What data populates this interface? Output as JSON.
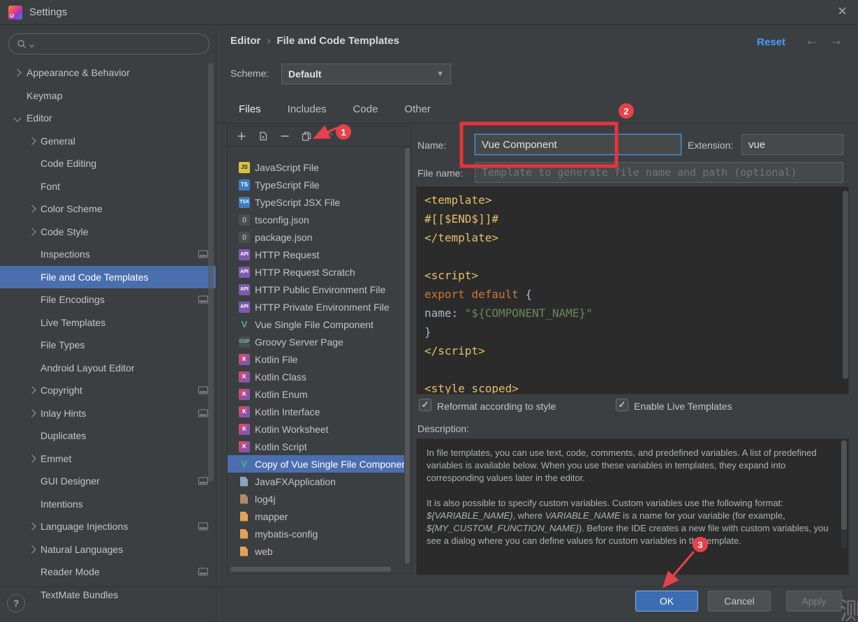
{
  "window": {
    "title": "Settings",
    "close_icon": "×"
  },
  "sidebar": {
    "search_placeholder": "",
    "items": [
      {
        "label": "Appearance & Behavior",
        "level": 1,
        "chevron": "right"
      },
      {
        "label": "Keymap",
        "level": 1
      },
      {
        "label": "Editor",
        "level": 1,
        "chevron": "down"
      },
      {
        "label": "General",
        "level": 2,
        "chevron": "right"
      },
      {
        "label": "Code Editing",
        "level": 2
      },
      {
        "label": "Font",
        "level": 2
      },
      {
        "label": "Color Scheme",
        "level": 2,
        "chevron": "right"
      },
      {
        "label": "Code Style",
        "level": 2,
        "chevron": "right"
      },
      {
        "label": "Inspections",
        "level": 2,
        "badge": true
      },
      {
        "label": "File and Code Templates",
        "level": 2,
        "selected": true
      },
      {
        "label": "File Encodings",
        "level": 2,
        "badge": true
      },
      {
        "label": "Live Templates",
        "level": 2
      },
      {
        "label": "File Types",
        "level": 2
      },
      {
        "label": "Android Layout Editor",
        "level": 2
      },
      {
        "label": "Copyright",
        "level": 2,
        "chevron": "right",
        "badge": true
      },
      {
        "label": "Inlay Hints",
        "level": 2,
        "chevron": "right",
        "badge": true
      },
      {
        "label": "Duplicates",
        "level": 2
      },
      {
        "label": "Emmet",
        "level": 2,
        "chevron": "right"
      },
      {
        "label": "GUI Designer",
        "level": 2,
        "badge": true
      },
      {
        "label": "Intentions",
        "level": 2
      },
      {
        "label": "Language Injections",
        "level": 2,
        "chevron": "right",
        "badge": true
      },
      {
        "label": "Natural Languages",
        "level": 2,
        "chevron": "right"
      },
      {
        "label": "Reader Mode",
        "level": 2,
        "badge": true
      },
      {
        "label": "TextMate Bundles",
        "level": 2
      }
    ],
    "help_label": "?"
  },
  "header": {
    "breadcrumb_1": "Editor",
    "breadcrumb_sep": "›",
    "breadcrumb_2": "File and Code Templates",
    "reset_label": "Reset",
    "back_icon": "←",
    "forward_icon": "→"
  },
  "scheme": {
    "label": "Scheme:",
    "value": "Default"
  },
  "tabs": [
    {
      "label": "Files",
      "active": true
    },
    {
      "label": "Includes"
    },
    {
      "label": "Code"
    },
    {
      "label": "Other"
    }
  ],
  "template_list": {
    "items": [
      {
        "label": "JavaScript File",
        "icon": "JS",
        "icon_bg": "#d9c441",
        "icon_fg": "#2b2b2b"
      },
      {
        "label": "TypeScript File",
        "icon": "TS",
        "icon_bg": "#3c7bbf",
        "icon_fg": "#ffffff"
      },
      {
        "label": "TypeScript JSX File",
        "icon": "TSX",
        "icon_bg": "#3c7bbf",
        "icon_fg": "#ffffff"
      },
      {
        "label": "tsconfig.json",
        "icon": "{}",
        "icon_bg": "#4a4e50",
        "icon_fg": "#b5c0c7"
      },
      {
        "label": "package.json",
        "icon": "{}",
        "icon_bg": "#4a4e50",
        "icon_fg": "#b5c0c7"
      },
      {
        "label": "HTTP Request",
        "icon": "API",
        "icon_bg": "#7d5bb0",
        "icon_fg": "#ffffff"
      },
      {
        "label": "HTTP Request Scratch",
        "icon": "API",
        "icon_bg": "#7d5bb0",
        "icon_fg": "#ffffff"
      },
      {
        "label": "HTTP Public Environment File",
        "icon": "API",
        "icon_bg": "#7d5bb0",
        "icon_fg": "#ffffff"
      },
      {
        "label": "HTTP Private Environment File",
        "icon": "API",
        "icon_bg": "#7d5bb0",
        "icon_fg": "#ffffff"
      },
      {
        "label": "Vue Single File Component",
        "icon": "V",
        "icon_bg": "transparent",
        "icon_fg": "#42b883"
      },
      {
        "label": "Groovy Server Page",
        "icon": "GSP",
        "icon_bg": "#4a4e50",
        "icon_fg": "#79c99d"
      },
      {
        "label": "Kotlin File",
        "icon": "K",
        "icon_bg": "linear-gradient(135deg,#e24f59,#9e4d9e 55%,#6563b5)",
        "icon_fg": "#ffffff"
      },
      {
        "label": "Kotlin Class",
        "icon": "K",
        "icon_bg": "linear-gradient(135deg,#e24f59,#9e4d9e 55%,#6563b5)",
        "icon_fg": "#ffffff"
      },
      {
        "label": "Kotlin Enum",
        "icon": "K",
        "icon_bg": "linear-gradient(135deg,#e24f59,#9e4d9e 55%,#6563b5)",
        "icon_fg": "#ffffff"
      },
      {
        "label": "Kotlin Interface",
        "icon": "K",
        "icon_bg": "linear-gradient(135deg,#e24f59,#9e4d9e 55%,#6563b5)",
        "icon_fg": "#ffffff"
      },
      {
        "label": "Kotlin Worksheet",
        "icon": "K",
        "icon_bg": "linear-gradient(135deg,#e24f59,#9e4d9e 55%,#6563b5)",
        "icon_fg": "#ffffff"
      },
      {
        "label": "Kotlin Script",
        "icon": "K",
        "icon_bg": "linear-gradient(135deg,#e24f59,#9e4d9e 55%,#6563b5)",
        "icon_fg": "#ffffff"
      },
      {
        "label": "Copy of Vue Single File Component",
        "icon": "V",
        "icon_bg": "transparent",
        "icon_fg": "#42b883",
        "selected": true
      },
      {
        "label": "JavaFXApplication",
        "icon": "file",
        "icon_fg": "#87a6c0"
      },
      {
        "label": "log4j",
        "icon": "file",
        "icon_fg": "#b08968"
      },
      {
        "label": "mapper",
        "icon": "file",
        "icon_fg": "#e2a256"
      },
      {
        "label": "mybatis-config",
        "icon": "file",
        "icon_fg": "#e2a256"
      },
      {
        "label": "web",
        "icon": "file",
        "icon_fg": "#e2a256"
      }
    ]
  },
  "detail": {
    "name_label": "Name:",
    "name_value": "Vue Component",
    "extension_label": "Extension:",
    "extension_value": "vue",
    "filename_label": "File name:",
    "filename_placeholder": "Template to generate file name and path (optional)",
    "code_lines": [
      [
        {
          "t": "<template>",
          "c": "tag"
        }
      ],
      [
        {
          "t": "#[[$END$]]#",
          "c": "tag"
        }
      ],
      [
        {
          "t": "</template>",
          "c": "tag"
        }
      ],
      [],
      [
        {
          "t": "<script>",
          "c": "tag"
        }
      ],
      [
        {
          "t": "export default ",
          "c": "kw"
        },
        {
          "t": "{",
          "c": "plain"
        }
      ],
      [
        {
          "t": "name: ",
          "c": "plain"
        },
        {
          "t": "\"${COMPONENT_NAME}\"",
          "c": "str"
        }
      ],
      [
        {
          "t": "}",
          "c": "plain"
        }
      ],
      [
        {
          "t": "</script>",
          "c": "tag"
        }
      ],
      [],
      [
        {
          "t": "<style scoped>",
          "c": "tag"
        }
      ]
    ],
    "reformat_checkbox": "Reformat according to style",
    "live_templates_checkbox": "Enable Live Templates",
    "checkmark": "✓",
    "description_label": "Description:",
    "description": [
      [
        {
          "t": "In file templates, you can use text, code, comments, and predefined variables. A list of predefined variables is available below. When you use these variables in templates, they expand into corresponding values later in the editor."
        }
      ],
      [
        {
          "t": "It is also possible to specify custom variables. Custom variables use the following format: "
        },
        {
          "t": "${VARIABLE_NAME}",
          "i": true
        },
        {
          "t": ", where "
        },
        {
          "t": "VARIABLE_NAME",
          "i": true
        },
        {
          "t": " is a name for your variable (for example, "
        },
        {
          "t": "${MY_CUSTOM_FUNCTION_NAME}",
          "i": true
        },
        {
          "t": "). Before the IDE creates a new file with custom variables, you see a dialog where you can define values for custom variables in the template."
        }
      ]
    ]
  },
  "footer": {
    "ok": "OK",
    "cancel": "Cancel",
    "apply": "Apply"
  },
  "annotations": {
    "step1": "1",
    "step2": "2",
    "step3": "3"
  },
  "watermark": "测"
}
